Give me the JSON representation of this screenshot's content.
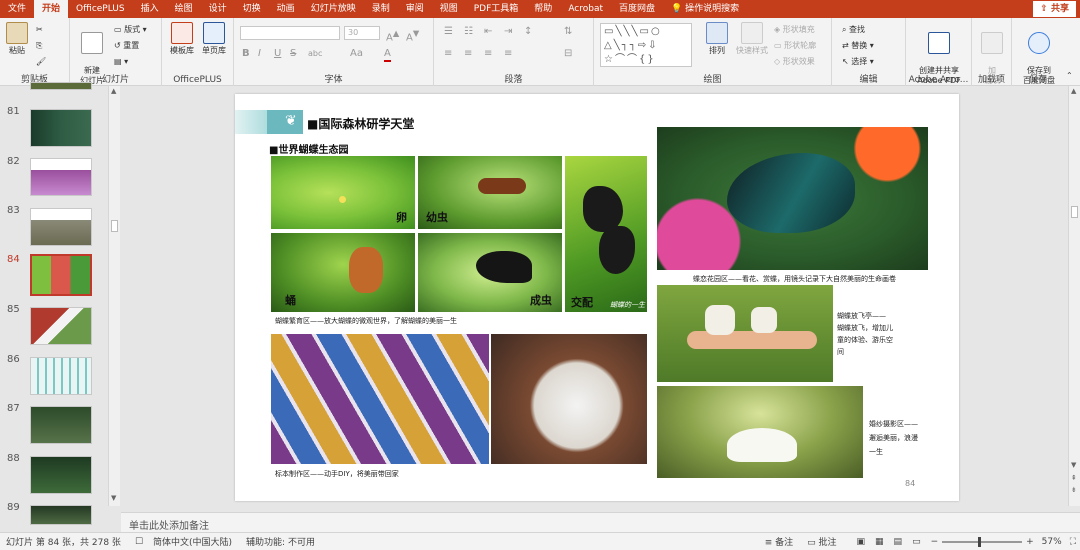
{
  "tabs": [
    "文件",
    "开始",
    "OfficePLUS",
    "插入",
    "绘图",
    "设计",
    "切换",
    "动画",
    "幻灯片放映",
    "录制",
    "审阅",
    "视图",
    "PDF工具箱",
    "帮助",
    "Acrobat",
    "百度网盘"
  ],
  "active_tab": "开始",
  "tell_me": "操作说明搜索",
  "share_label": "共享",
  "ribbon": {
    "clipboard": {
      "paste": "粘贴",
      "label": "剪贴板"
    },
    "slides": {
      "new_slide": "新建\n幻灯片",
      "layout": "版式",
      "reset": "重置",
      "section": "",
      "label": "幻灯片"
    },
    "officeplus": {
      "templates": "模板库",
      "single_pages": "单页库",
      "label": "OfficePLUS"
    },
    "font": {
      "font_size": "30",
      "label": "字体",
      "bold": "B",
      "italic": "I",
      "underline": "U",
      "strike": "S",
      "spacing": "abc",
      "aa": "Aa",
      "color": "A"
    },
    "paragraph": {
      "label": "段落"
    },
    "drawing": {
      "arrange": "排列",
      "quick_styles": "快速样式",
      "shape_fill": "形状填充",
      "shape_outline": "形状轮廓",
      "shape_effects": "形状效果",
      "label": "绘图"
    },
    "editing": {
      "find": "查找",
      "replace": "替换",
      "select": "选择",
      "label": "编辑"
    },
    "adobe": {
      "create": "创建并共享\nAdobe PDF",
      "label": "Adobe Acro..."
    },
    "addins": {
      "load": "加\n载项",
      "label": "加载项"
    },
    "save": {
      "save_to": "保存到\n百度网盘",
      "label": "保存"
    }
  },
  "thumbnails": [
    "81",
    "82",
    "83",
    "84",
    "85",
    "86",
    "87",
    "88",
    "89"
  ],
  "selected_slide": "84",
  "slide": {
    "title": "■国际森林研学天堂",
    "subtitle": "■世界蝴蝶生态园",
    "labels": {
      "egg": "卵",
      "larva": "幼虫",
      "pupa": "蛹",
      "adult": "成虫",
      "mating": "交配",
      "cycle": "蝴蝶的一生"
    },
    "caption_lifecycle": "蝴蝶繁育区——放大蝴蝶的微观世界，了解蝴蝶的美丽一生",
    "caption_flower": "蝶恋花园区——看花、赏蝶，用镜头记录下大自然美丽的生命画卷",
    "caption_release_1": "蝴蝶放飞亭——",
    "caption_release_2": "蝴蝶放飞，增加儿",
    "caption_release_3": "童的体验、游乐空",
    "caption_release_4": "间",
    "caption_specimen": "标本制作区——动手DIY，将美丽带回家",
    "caption_wedding_1": "婚纱摄影区——",
    "caption_wedding_2": "邂逅美丽，浪漫",
    "caption_wedding_3": "一生",
    "page_number": "84"
  },
  "notes_placeholder": "单击此处添加备注",
  "status": {
    "slide_info": "幻灯片 第 84 张，共 278 张",
    "language": "简体中文(中国大陆)",
    "accessibility": "辅助功能: 不可用",
    "notes": "备注",
    "comments": "批注",
    "zoom": "57%"
  }
}
